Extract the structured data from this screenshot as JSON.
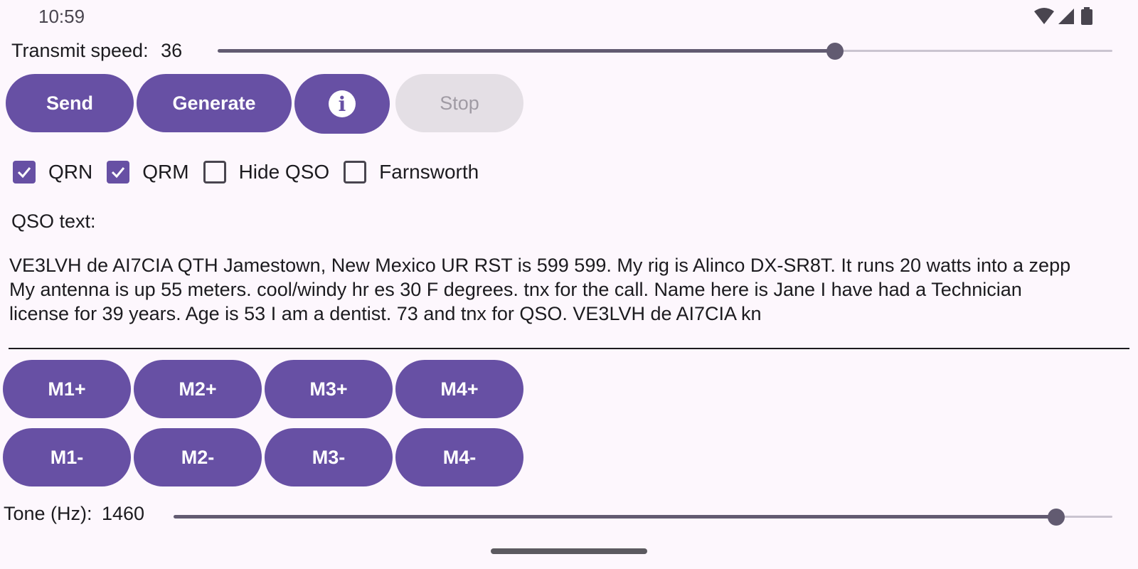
{
  "status_bar": {
    "time": "10:59",
    "icons": [
      "wifi-icon",
      "cell-signal-icon",
      "battery-icon"
    ]
  },
  "transmit_speed": {
    "label": "Transmit speed:",
    "value": "36",
    "fraction": 0.69
  },
  "actions": {
    "send": "Send",
    "generate": "Generate",
    "info_icon": "info-icon",
    "stop": "Stop",
    "stop_enabled": false
  },
  "options": [
    {
      "label": "QRN",
      "checked": true
    },
    {
      "label": "QRM",
      "checked": true
    },
    {
      "label": "Hide QSO",
      "checked": false
    },
    {
      "label": "Farnsworth",
      "checked": false
    }
  ],
  "qso": {
    "label": "QSO text:",
    "text": "VE3LVH de AI7CIA QTH Jamestown, New Mexico UR RST is 599 599. My rig is Alinco DX-SR8T. It runs 20 watts into a zepp\nMy antenna is up 55 meters. cool/windy hr es 30 F degrees. tnx for the call. Name here is Jane I have had a Technician\nlicense for 39 years. Age is 53 I am a dentist. 73 and tnx for QSO. VE3LVH de AI7CIA kn"
  },
  "memory": {
    "plus": [
      "M1+",
      "M2+",
      "M3+",
      "M4+"
    ],
    "minus": [
      "M1-",
      "M2-",
      "M3-",
      "M4-"
    ]
  },
  "tone": {
    "label": "Tone (Hz):",
    "value": "1460",
    "fraction": 0.94
  },
  "colors": {
    "primary": "#6750a4",
    "background": "#fdf7fd",
    "disabled": "#e4dfe5",
    "slider_active": "#625b71"
  }
}
